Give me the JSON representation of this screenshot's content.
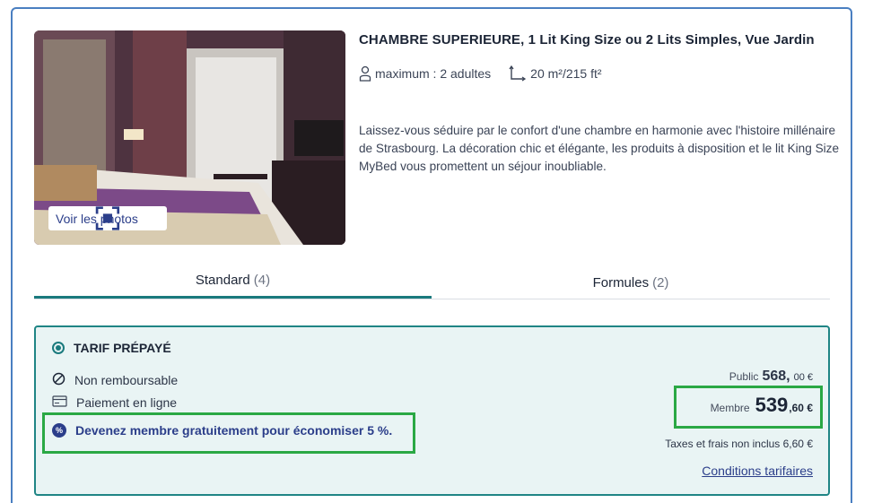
{
  "room": {
    "title": "CHAMBRE SUPERIEURE, 1 Lit King Size ou 2 Lits Simples, Vue Jardin",
    "capacity": "maximum : 2 adultes",
    "size": "20 m²/215 ft²",
    "description": "Laissez-vous séduire par le confort d'une chambre en harmonie avec l'histoire millénaire de Strasbourg. La décoration chic et élégante, les produits à disposition et le lit King Size MyBed vous promettent un séjour inoubliable.",
    "photos_button": "Voir les photos"
  },
  "tabs": [
    {
      "label": "Standard",
      "count": "(4)",
      "active": true
    },
    {
      "label": "Formules",
      "count": "(2)",
      "active": false
    }
  ],
  "rate": {
    "title": "TARIF PRÉPAYÉ",
    "conditions": [
      "Non remboursable",
      "Paiement en ligne"
    ],
    "promo": "Devenez membre gratuitement pour économiser 5 %.",
    "promo_badge": "%",
    "public_label": "Public",
    "public_amount": "568,",
    "public_cents": "00 €",
    "member_label": "Membre",
    "member_amount": "539",
    "member_cents": ",60 €",
    "taxes_label": "Taxes et frais non inclus",
    "taxes_value": "6,60 €",
    "conditions_link": "Conditions tarifaires"
  },
  "colors": {
    "accent": "#1a7a7d",
    "highlight": "#2aa844",
    "brand_blue": "#2b3e8a",
    "card_border": "#4a7fc1"
  },
  "icons": {
    "capacity": "person-icon",
    "size": "area-corner-icon",
    "photos": "expand-frame-icon",
    "non_refundable": "prohibited-icon",
    "payment": "credit-card-icon",
    "promo": "percent-badge-icon"
  }
}
